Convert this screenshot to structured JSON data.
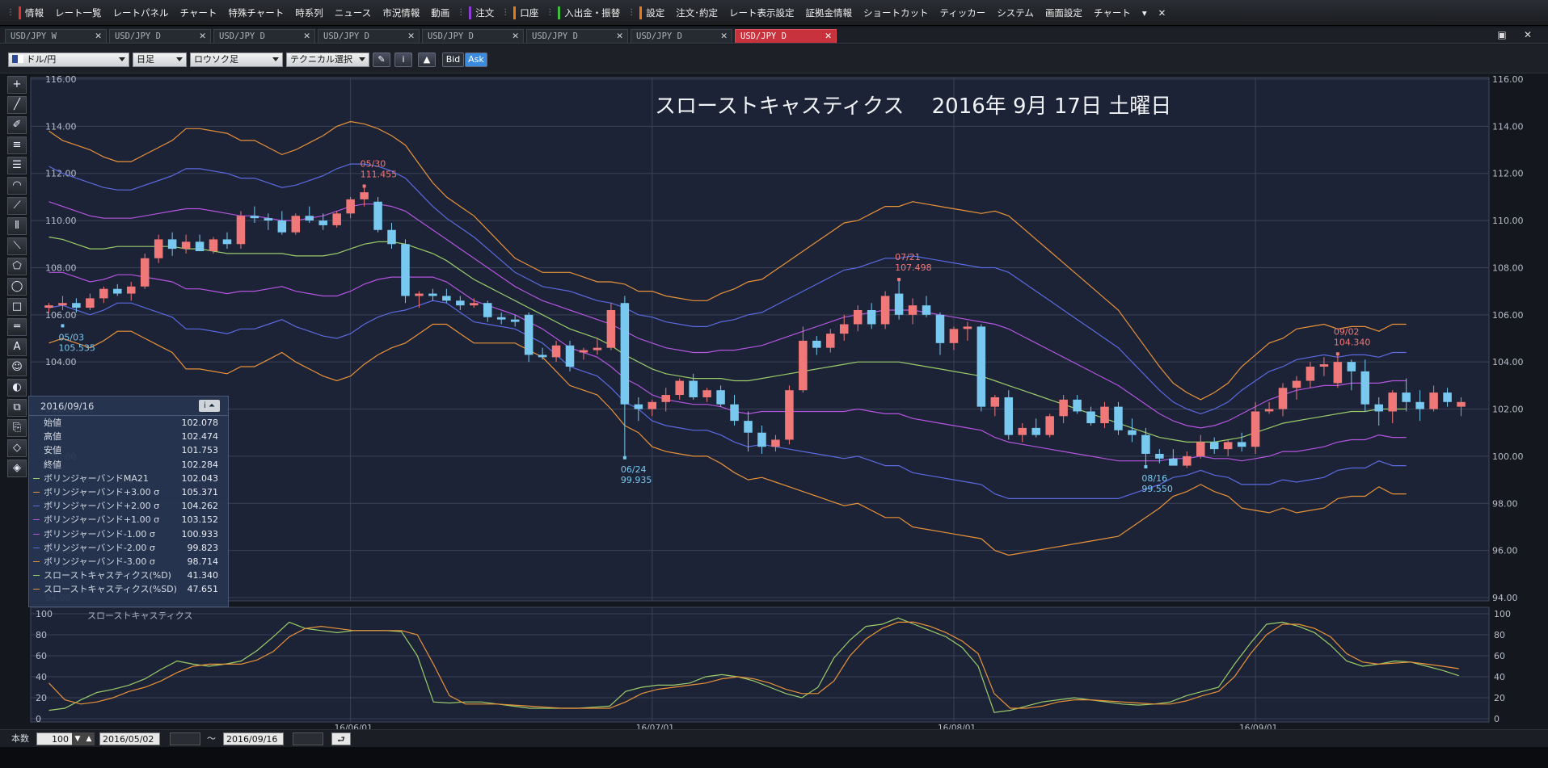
{
  "menu": [
    {
      "label": "情報",
      "color": "#e0342f"
    },
    {
      "label": "レート一覧"
    },
    {
      "label": "レートパネル"
    },
    {
      "label": "チャート"
    },
    {
      "label": "特殊チャート"
    },
    {
      "label": "時系列"
    },
    {
      "label": "ニュース"
    },
    {
      "label": "市況情報"
    },
    {
      "label": "動画"
    },
    {
      "label": "注文",
      "color": "#8b3fd6"
    },
    {
      "label": "口座",
      "color": "#e87a1c"
    },
    {
      "label": "入出金・振替",
      "color": "#3fbf3f"
    },
    {
      "label": "設定",
      "color": "#e87a1c"
    },
    {
      "label": "注文･約定"
    },
    {
      "label": "レート表示設定"
    },
    {
      "label": "証拠金情報"
    },
    {
      "label": "ショートカット"
    },
    {
      "label": "ティッカー"
    },
    {
      "label": "システム"
    },
    {
      "label": "画面設定"
    },
    {
      "label": "チャート"
    }
  ],
  "menu_extra": {
    "more": "▾",
    "close": "✕"
  },
  "tabs": [
    {
      "label": "USD/JPY W",
      "active": false
    },
    {
      "label": "USD/JPY D",
      "active": false
    },
    {
      "label": "USD/JPY D",
      "active": false
    },
    {
      "label": "USD/JPY D",
      "active": false
    },
    {
      "label": "USD/JPY D",
      "active": false
    },
    {
      "label": "USD/JPY D",
      "active": false
    },
    {
      "label": "USD/JPY D",
      "active": false
    },
    {
      "label": "USD/JPY D",
      "active": true
    }
  ],
  "tab_close": "✕",
  "window_buttons": {
    "restore": "▣",
    "close": "✕"
  },
  "toolbar": {
    "currency_pair": "ドル/円",
    "timeframe": "日足",
    "chart_type": "ロウソク足",
    "technical": "テクニカル選択",
    "pencil_icon": "✎",
    "info_icon": "i",
    "area_icon": "▲",
    "bid": "Bid",
    "ask": "Ask"
  },
  "left_tools": [
    "+",
    "╱",
    "✐",
    "≡",
    "☰",
    "◠",
    "⟋",
    "⦀",
    "⟍",
    "⬠",
    "◯",
    "□",
    "═",
    "A",
    "☺",
    "◐",
    "⧉",
    "⎘",
    "◇",
    "◈"
  ],
  "chart_title": "スローストキャスティクス　 2016年 9月 17日 土曜日",
  "subchart_label": "スローストキャスティクス",
  "infobox": {
    "date": "2016/09/16",
    "icons": "i ⏶",
    "rows": [
      {
        "label": "始値",
        "value": "102.078",
        "color": ""
      },
      {
        "label": "高値",
        "value": "102.474",
        "color": ""
      },
      {
        "label": "安値",
        "value": "101.753",
        "color": ""
      },
      {
        "label": "終値",
        "value": "102.284",
        "color": ""
      },
      {
        "label": "ボリンジャーバンドMA21",
        "value": "102.043",
        "color": "#9acd6a"
      },
      {
        "label": "ボリンジャーバンド+3.00 σ",
        "value": "105.371",
        "color": "#e8923a"
      },
      {
        "label": "ボリンジャーバンド+2.00 σ",
        "value": "104.262",
        "color": "#5a6be0"
      },
      {
        "label": "ボリンジャーバンド+1.00 σ",
        "value": "103.152",
        "color": "#b455e0"
      },
      {
        "label": "ボリンジャーバンド-1.00 σ",
        "value": "100.933",
        "color": "#b455e0"
      },
      {
        "label": "ボリンジャーバンド-2.00 σ",
        "value": "99.823",
        "color": "#5a6be0"
      },
      {
        "label": "ボリンジャーバンド-3.00 σ",
        "value": "98.714",
        "color": "#e8923a"
      },
      {
        "label": "スローストキャスティクス(%D)",
        "value": "41.340",
        "color": "#9acd6a"
      },
      {
        "label": "スローストキャスティクス(%SD)",
        "value": "47.651",
        "color": "#e8923a"
      }
    ]
  },
  "bottom": {
    "count_label": "本数",
    "count": "100",
    "from": "2016/05/02",
    "tilde": "〜",
    "to": "2016/09/16",
    "enter_icon": "⮐"
  },
  "colors": {
    "up": "#f07878",
    "down": "#78c8f0",
    "ma": "#9acd6a",
    "s1": "#b455e0",
    "s2": "#5a6be0",
    "s3": "#e8923a",
    "bg": "#1c2336",
    "grid": "#3a4258"
  },
  "chart_data": {
    "type": "candlestick",
    "ylim": [
      94,
      116
    ],
    "yticks": [
      "116.00",
      "114.00",
      "112.00",
      "110.00",
      "108.00",
      "106.00",
      "104.00",
      "102.00",
      "100.00",
      "98.00",
      "96.00",
      "94.00"
    ],
    "xticks": [
      "16/06/01",
      "16/07/01",
      "16/08/01",
      "16/09/01"
    ],
    "xtick_index": [
      22,
      44,
      66,
      88
    ],
    "sub_yticks": [
      "100",
      "80",
      "60",
      "40",
      "20",
      "0"
    ],
    "candles": [
      [
        106.3,
        106.5,
        106.1,
        106.4
      ],
      [
        106.4,
        106.8,
        106.2,
        106.5
      ],
      [
        106.5,
        106.7,
        106.1,
        106.3
      ],
      [
        106.3,
        106.9,
        106.2,
        106.7
      ],
      [
        106.7,
        107.2,
        106.5,
        107.1
      ],
      [
        107.1,
        107.3,
        106.8,
        106.9
      ],
      [
        106.9,
        107.4,
        106.6,
        107.2
      ],
      [
        107.2,
        108.6,
        107.1,
        108.4
      ],
      [
        108.4,
        109.4,
        108.2,
        109.2
      ],
      [
        109.2,
        109.5,
        108.5,
        108.8
      ],
      [
        108.8,
        109.4,
        108.6,
        109.1
      ],
      [
        109.1,
        109.4,
        108.9,
        108.7
      ],
      [
        108.7,
        109.3,
        108.6,
        109.2
      ],
      [
        109.2,
        109.5,
        108.8,
        109.0
      ],
      [
        109.0,
        110.4,
        108.8,
        110.2
      ],
      [
        110.2,
        110.6,
        109.9,
        110.1
      ],
      [
        110.1,
        110.3,
        109.6,
        110.0
      ],
      [
        110.0,
        110.4,
        109.4,
        109.5
      ],
      [
        109.5,
        110.3,
        109.4,
        110.2
      ],
      [
        110.2,
        110.6,
        109.9,
        110.0
      ],
      [
        110.0,
        110.3,
        109.6,
        109.8
      ],
      [
        109.8,
        110.4,
        109.7,
        110.3
      ],
      [
        110.3,
        111.0,
        110.1,
        110.9
      ],
      [
        110.9,
        111.46,
        110.6,
        111.2
      ],
      [
        110.8,
        111.0,
        109.5,
        109.6
      ],
      [
        109.6,
        109.9,
        108.8,
        109.0
      ],
      [
        109.0,
        109.2,
        106.5,
        106.8
      ],
      [
        106.8,
        107.0,
        106.3,
        106.9
      ],
      [
        106.9,
        107.1,
        106.6,
        106.8
      ],
      [
        106.8,
        107.1,
        106.5,
        106.6
      ],
      [
        106.6,
        106.8,
        106.2,
        106.4
      ],
      [
        106.4,
        106.7,
        106.3,
        106.5
      ],
      [
        106.5,
        106.6,
        105.7,
        105.9
      ],
      [
        105.9,
        106.1,
        105.6,
        105.8
      ],
      [
        105.8,
        106.0,
        105.5,
        105.7
      ],
      [
        106.0,
        106.1,
        104.0,
        104.3
      ],
      [
        104.3,
        104.6,
        104.1,
        104.2
      ],
      [
        104.2,
        104.9,
        104.0,
        104.7
      ],
      [
        104.7,
        104.9,
        103.6,
        103.8
      ],
      [
        104.4,
        104.6,
        104.1,
        104.5
      ],
      [
        104.5,
        105.0,
        104.3,
        104.6
      ],
      [
        104.6,
        106.5,
        104.5,
        106.2
      ],
      [
        106.5,
        106.8,
        99.94,
        102.2
      ],
      [
        102.2,
        102.5,
        101.5,
        102.0
      ],
      [
        102.0,
        102.4,
        101.7,
        102.3
      ],
      [
        102.3,
        102.9,
        101.9,
        102.6
      ],
      [
        102.6,
        103.3,
        102.4,
        103.2
      ],
      [
        103.2,
        103.5,
        102.4,
        102.5
      ],
      [
        102.5,
        102.9,
        102.3,
        102.8
      ],
      [
        102.8,
        103.0,
        102.1,
        102.2
      ],
      [
        102.2,
        102.6,
        101.3,
        101.5
      ],
      [
        101.5,
        101.9,
        100.2,
        101.0
      ],
      [
        101.0,
        101.3,
        100.1,
        100.4
      ],
      [
        100.4,
        100.9,
        100.2,
        100.7
      ],
      [
        100.7,
        103.0,
        100.5,
        102.8
      ],
      [
        102.8,
        105.5,
        102.7,
        104.9
      ],
      [
        104.9,
        105.1,
        104.3,
        104.6
      ],
      [
        104.6,
        105.4,
        104.4,
        105.2
      ],
      [
        105.2,
        106.0,
        104.9,
        105.6
      ],
      [
        105.6,
        106.4,
        105.3,
        106.2
      ],
      [
        106.2,
        106.5,
        105.4,
        105.6
      ],
      [
        105.6,
        107.0,
        105.4,
        106.8
      ],
      [
        106.9,
        107.5,
        105.8,
        106.0
      ],
      [
        106.0,
        106.7,
        105.6,
        106.4
      ],
      [
        106.4,
        106.8,
        105.9,
        106.0
      ],
      [
        106.0,
        106.1,
        104.3,
        104.8
      ],
      [
        104.8,
        105.5,
        104.5,
        105.4
      ],
      [
        105.4,
        105.7,
        104.9,
        105.5
      ],
      [
        105.5,
        105.6,
        101.9,
        102.1
      ],
      [
        102.1,
        102.6,
        101.7,
        102.5
      ],
      [
        102.5,
        102.8,
        100.7,
        100.9
      ],
      [
        100.9,
        101.4,
        100.6,
        101.2
      ],
      [
        101.2,
        101.6,
        100.8,
        100.9
      ],
      [
        100.9,
        101.8,
        100.8,
        101.7
      ],
      [
        101.7,
        102.6,
        101.4,
        102.4
      ],
      [
        102.4,
        102.6,
        101.8,
        101.9
      ],
      [
        101.9,
        102.1,
        101.3,
        101.4
      ],
      [
        101.4,
        102.3,
        101.2,
        102.1
      ],
      [
        102.1,
        102.3,
        100.9,
        101.1
      ],
      [
        101.1,
        101.6,
        100.6,
        100.9
      ],
      [
        100.9,
        101.2,
        99.55,
        100.1
      ],
      [
        100.1,
        100.3,
        99.7,
        99.9
      ],
      [
        99.9,
        100.3,
        99.6,
        99.6
      ],
      [
        99.6,
        100.2,
        99.5,
        100.0
      ],
      [
        100.0,
        100.9,
        99.9,
        100.6
      ],
      [
        100.6,
        100.8,
        100.1,
        100.3
      ],
      [
        100.3,
        100.7,
        100.0,
        100.6
      ],
      [
        100.6,
        101.0,
        100.2,
        100.4
      ],
      [
        100.4,
        102.3,
        100.1,
        101.9
      ],
      [
        101.9,
        102.3,
        101.8,
        102.0
      ],
      [
        102.0,
        103.1,
        101.7,
        102.9
      ],
      [
        102.9,
        103.4,
        102.4,
        103.2
      ],
      [
        103.2,
        104.0,
        102.9,
        103.8
      ],
      [
        103.8,
        104.2,
        103.4,
        103.9
      ],
      [
        103.1,
        104.34,
        102.9,
        104.0
      ],
      [
        104.0,
        104.1,
        102.8,
        103.6
      ],
      [
        103.6,
        104.1,
        101.9,
        102.2
      ],
      [
        102.2,
        102.5,
        101.3,
        101.9
      ],
      [
        101.9,
        102.8,
        101.4,
        102.7
      ],
      [
        102.7,
        103.3,
        101.9,
        102.3
      ],
      [
        102.3,
        102.8,
        101.5,
        102.0
      ],
      [
        102.0,
        103.0,
        101.9,
        102.7
      ],
      [
        102.7,
        102.9,
        102.1,
        102.3
      ],
      [
        102.1,
        102.5,
        101.7,
        102.3
      ]
    ],
    "bb_ma": [
      109.3,
      109.2,
      109.0,
      108.8,
      108.8,
      108.9,
      108.9,
      108.9,
      108.9,
      108.9,
      108.8,
      108.8,
      108.7,
      108.6,
      108.6,
      108.6,
      108.6,
      108.6,
      108.5,
      108.5,
      108.5,
      108.6,
      108.8,
      109.0,
      109.1,
      109.1,
      109.0,
      108.8,
      108.6,
      108.3,
      107.9,
      107.5,
      107.2,
      106.9,
      106.6,
      106.3,
      106.0,
      105.7,
      105.4,
      105.2,
      105.0,
      104.7,
      104.3,
      104.0,
      103.7,
      103.5,
      103.4,
      103.3,
      103.3,
      103.3,
      103.2,
      103.2,
      103.3,
      103.4,
      103.5,
      103.6,
      103.7,
      103.8,
      103.9,
      104.0,
      104.0,
      104.0,
      104.0,
      103.9,
      103.8,
      103.7,
      103.6,
      103.5,
      103.4,
      103.2,
      103.0,
      102.8,
      102.6,
      102.4,
      102.2,
      102.0,
      101.8,
      101.6,
      101.4,
      101.2,
      101.0,
      100.8,
      100.7,
      100.6,
      100.6,
      100.6,
      100.7,
      100.8,
      101.0,
      101.2,
      101.4,
      101.5,
      101.6,
      101.7,
      101.8,
      101.9,
      101.9,
      102.0,
      102.0,
      102.0
    ],
    "bb_p1": [
      110.8,
      110.6,
      110.4,
      110.2,
      110.0,
      110.0,
      110.1,
      110.2,
      110.3,
      110.4,
      110.5,
      110.5,
      110.4,
      110.3,
      110.2,
      110.2,
      110.1,
      110.0,
      110.0,
      110.1,
      110.2,
      110.4,
      110.6,
      110.7,
      110.7,
      110.6,
      110.4,
      110.0,
      109.6,
      109.2,
      108.8,
      108.4,
      108.0,
      107.6,
      107.2,
      106.9,
      106.6,
      106.4,
      106.2,
      106.0,
      105.8,
      105.6,
      105.3,
      105.0,
      104.8,
      104.6,
      104.5,
      104.4,
      104.4,
      104.5,
      104.5,
      104.6,
      104.7,
      104.9,
      105.1,
      105.3,
      105.5,
      105.7,
      105.9,
      106.0,
      106.1,
      106.2,
      106.2,
      106.2,
      106.1,
      106.0,
      105.9,
      105.8,
      105.7,
      105.6,
      105.4,
      105.1,
      104.8,
      104.5,
      104.2,
      103.9,
      103.6,
      103.3,
      103.0,
      102.6,
      102.2,
      101.8,
      101.5,
      101.3,
      101.2,
      101.3,
      101.5,
      101.8,
      102.1,
      102.4,
      102.6,
      102.8,
      102.9,
      103.0,
      103.0,
      103.1,
      103.1,
      103.1,
      103.2,
      103.2
    ],
    "sd": [
      1.5,
      1.4,
      1.4,
      1.4,
      1.3,
      1.2,
      1.2,
      1.3,
      1.4,
      1.5,
      1.7,
      1.7,
      1.7,
      1.7,
      1.6,
      1.6,
      1.5,
      1.4,
      1.5,
      1.6,
      1.7,
      1.8,
      1.8,
      1.7,
      1.6,
      1.5,
      1.4,
      1.2,
      1.0,
      0.9,
      0.9,
      0.9,
      0.8,
      0.7,
      0.6,
      0.6,
      0.6,
      0.7,
      0.8,
      0.8,
      0.8,
      0.9,
      1.0,
      1.0,
      1.1,
      1.1,
      1.1,
      1.1,
      1.1,
      1.2,
      1.3,
      1.4,
      1.4,
      1.5,
      1.6,
      1.7,
      1.8,
      1.9,
      2.0,
      2.0,
      2.1,
      2.2,
      2.2,
      2.3,
      2.3,
      2.3,
      2.3,
      2.3,
      2.3,
      2.4,
      2.4,
      2.3,
      2.2,
      2.1,
      2.0,
      1.9,
      1.8,
      1.7,
      1.6,
      1.4,
      1.2,
      1.0,
      0.8,
      0.7,
      0.6,
      0.7,
      0.8,
      1.0,
      1.1,
      1.2,
      1.2,
      1.3,
      1.3,
      1.3,
      1.2,
      1.2,
      1.2,
      1.1,
      1.2,
      1.2
    ],
    "stoch_d": [
      8,
      10,
      18,
      25,
      28,
      32,
      38,
      47,
      55,
      52,
      50,
      52,
      55,
      65,
      78,
      92,
      86,
      84,
      82,
      84,
      84,
      84,
      83,
      60,
      16,
      15,
      16,
      16,
      14,
      12,
      10,
      10,
      10,
      10,
      11,
      12,
      26,
      30,
      32,
      32,
      34,
      40,
      42,
      40,
      36,
      30,
      24,
      20,
      30,
      58,
      75,
      88,
      90,
      96,
      90,
      84,
      78,
      68,
      50,
      6,
      8,
      12,
      16,
      18,
      20,
      18,
      16,
      14,
      13,
      14,
      16,
      22,
      26,
      30,
      52,
      72,
      90,
      92,
      88,
      82,
      70,
      55,
      50,
      52,
      55,
      54,
      50,
      46,
      41
    ],
    "stoch_sd": [
      34,
      18,
      14,
      16,
      20,
      26,
      30,
      36,
      44,
      50,
      52,
      52,
      52,
      56,
      64,
      78,
      86,
      88,
      86,
      84,
      84,
      84,
      84,
      80,
      52,
      22,
      14,
      14,
      14,
      13,
      12,
      11,
      10,
      10,
      10,
      10,
      16,
      24,
      28,
      30,
      32,
      34,
      38,
      40,
      38,
      34,
      28,
      24,
      24,
      36,
      60,
      76,
      86,
      92,
      92,
      88,
      82,
      74,
      62,
      24,
      10,
      10,
      12,
      16,
      18,
      18,
      17,
      16,
      15,
      14,
      14,
      17,
      22,
      26,
      40,
      62,
      80,
      90,
      90,
      86,
      78,
      62,
      54,
      52,
      53,
      54,
      52,
      50,
      47.7
    ]
  },
  "labels": [
    {
      "date": "05/30",
      "price": "111.455",
      "color": "#f07878",
      "idx": 23,
      "y": 111.46,
      "pos": "above"
    },
    {
      "date": "05/03",
      "price": "105.535",
      "color": "#78c8f0",
      "idx": 1,
      "y": 105.535,
      "pos": "below"
    },
    {
      "date": "07/21",
      "price": "107.498",
      "color": "#f07878",
      "idx": 62,
      "y": 107.498,
      "pos": "above"
    },
    {
      "date": "06/24",
      "price": "99.935",
      "color": "#78c8f0",
      "idx": 42,
      "y": 99.935,
      "pos": "below"
    },
    {
      "date": "08/16",
      "price": "99.550",
      "color": "#78c8f0",
      "idx": 80,
      "y": 99.55,
      "pos": "below"
    },
    {
      "date": "09/02",
      "price": "104.340",
      "color": "#f07878",
      "idx": 94,
      "y": 104.34,
      "pos": "above"
    }
  ]
}
